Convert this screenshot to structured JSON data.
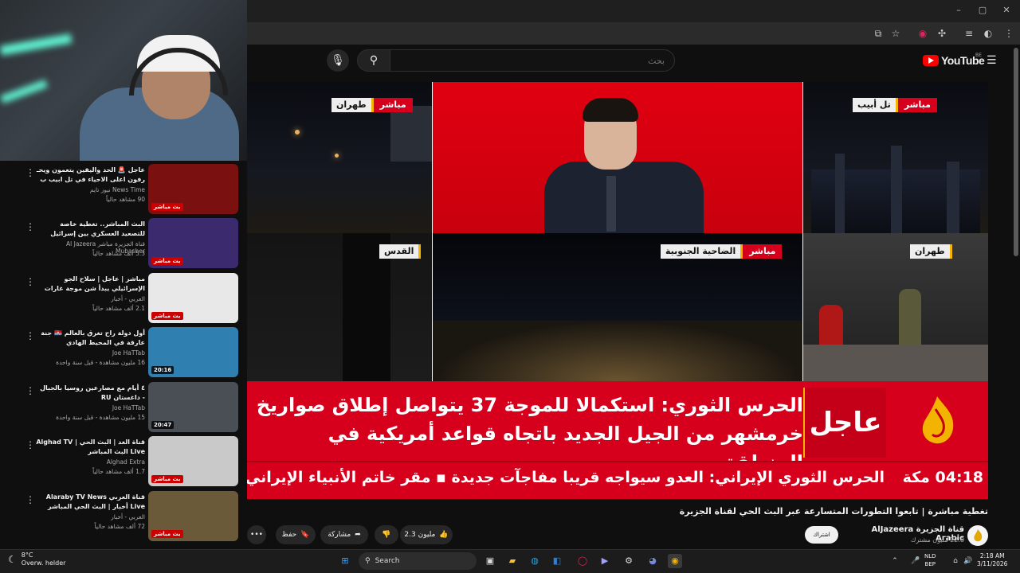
{
  "browser": {
    "window_controls": {
      "minimize": "–",
      "maximize": "▢",
      "close": "✕"
    }
  },
  "youtube": {
    "logo_text": "YouTube",
    "region": "BE",
    "search_placeholder": "بحث"
  },
  "video": {
    "tiles": [
      {
        "live": "مباشر",
        "city": "طهران"
      },
      {
        "live": "مباشر",
        "city": "تل أبيب"
      },
      {
        "city": "القدس"
      },
      {
        "live": "مباشر",
        "city": "الضاحية الجنوبية"
      },
      {
        "city": "طهران"
      }
    ],
    "breaking_label": "عاجل",
    "headline_line1": "الحرس الثوري: استكمالا للموجة 37 يتواصل إطلاق صواريخ",
    "headline_line2": "خرمشهر من الجيل الجديد باتجاه قواعد أمريكية في المنطقة",
    "ticker_time": "04:18 مكة",
    "ticker_text": "الحرس الثوري الإيراني: العدو سيواجه قريبا مفاجآت جديدة   ▪   مقر خاتم الأنبياء الإيراني: أ",
    "title": "تغطية مباشرة | تابعوا التطورات المتسارعة عبر البث الحي لقناة الجزيرة",
    "channel_name": "قناة الجزيرة AlJazeera Arabic",
    "subscribers": "22.8 مليون مشترك",
    "subscribe_label": "اشتراك",
    "likes": "2.3 مليون",
    "share_label": "مشاركة",
    "save_label": "حفظ",
    "more_label": "•••"
  },
  "sidebar": {
    "items": [
      {
        "title": "عاجل 🚨 الحد واليقين يتعمون ويحـ رفون اعلى الاحياء في تل ابيب ب ...",
        "channel": "News Time نيوز تايم",
        "meta": "90 مشاهد حالياً",
        "badge": "بث مباشر",
        "thumb": "#7a1010"
      },
      {
        "title": "البث المباشر.. تغطية خاصة للتصعيد العسكري بين إسرائيل وأمريكا وإيران",
        "channel": "قناة الجزيرة مباشر Al Jazeera Mubasher",
        "meta": "5.3 ألف مشاهد حالياً",
        "badge": "بث مباشر",
        "thumb": "#3b2a6e"
      },
      {
        "title": "مباشر | عاجل | سلاح الجو الإسرائيلي يبدأ شن موجة غارات على المساحية الجوية ...",
        "channel": "العربي - أخبار",
        "meta": "2.1 ألف مشاهد حالياً",
        "badge": "بث مباشر",
        "thumb": "#e8e8e8"
      },
      {
        "title": "أول دولة راح تغرق بالعالم 🇰🇮 جنة عارقة في المحيط الهادي",
        "channel": "Joe HaTTab",
        "meta": "16 مليون مشاهدة - قبل سنة واحدة",
        "badge": "20:16",
        "thumb": "#2f7fb0"
      },
      {
        "title": "٤ أيام مع مصارعين روسيا بالجبال - داغستان RU",
        "channel": "Joe HaTTab",
        "meta": "15 مليون مشاهدة - قبل سنة واحدة",
        "badge": "20:47",
        "thumb": "#4a4f55"
      },
      {
        "title": "قناة الغد | البث الحي | Alghad TV Live البث المباشر",
        "channel": "Alghad Extra",
        "meta": "1.7 ألف مشاهد حالياً",
        "badge": "بث مباشر",
        "thumb": "#c9c9c9"
      },
      {
        "title": "قناة العربي Alaraby TV News Live أخبار | البث الحي المباشر",
        "channel": "العربي - أخبار",
        "meta": "72 ألف مشاهد حالياً",
        "badge": "بث مباشر",
        "thumb": "#6b5a3a"
      }
    ]
  },
  "taskbar": {
    "weather_temp": "8°C",
    "weather_desc": "Overw. helder",
    "search_label": "Search",
    "lang_line1": "NLD",
    "lang_line2": "BEP",
    "time": "2:18 AM",
    "date": "3/11/2026"
  }
}
